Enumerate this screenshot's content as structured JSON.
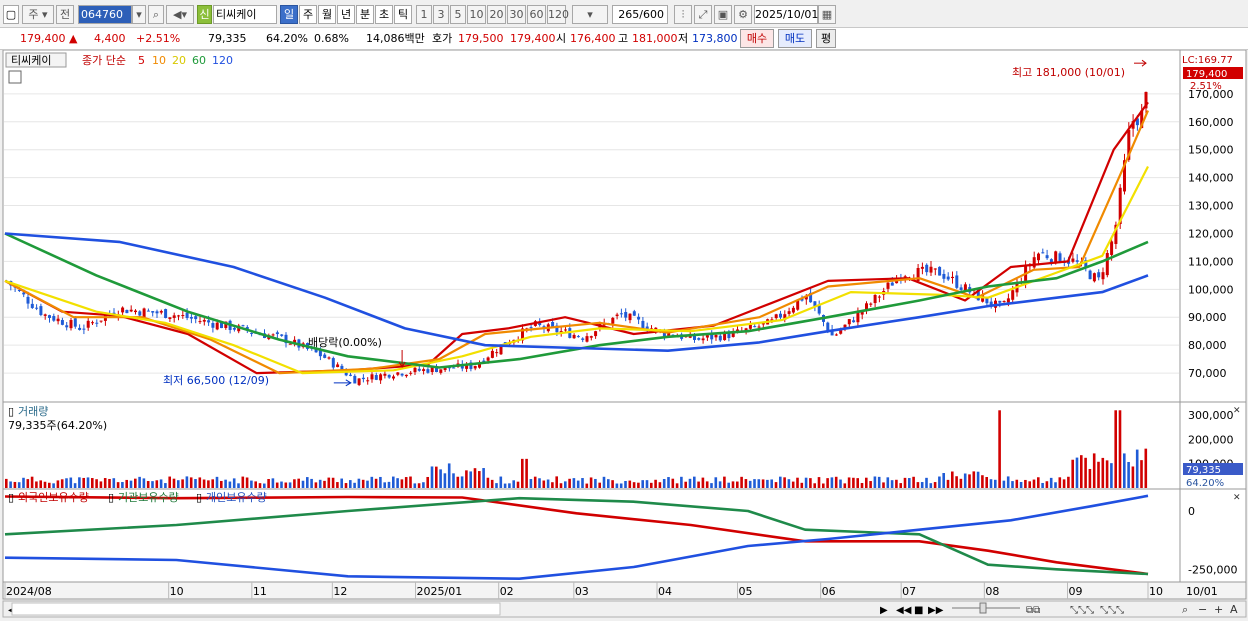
{
  "toolbar": {
    "period_selector": "주",
    "prev_label": "전",
    "stock_code": "064760",
    "credit_badge": "신",
    "stock_name": "티씨케이",
    "timeframes": [
      "일",
      "주",
      "월",
      "년",
      "분",
      "초",
      "틱"
    ],
    "active_timeframe": "일",
    "minute_intervals": [
      "1",
      "3",
      "5",
      "10",
      "20",
      "30",
      "60",
      "120"
    ],
    "count_value": "265",
    "count_total": "/600",
    "date_value": "2025/10/01"
  },
  "quote": {
    "price": "179,400",
    "change": "4,400",
    "change_pct": "+2.51%",
    "volume": "79,335",
    "volume_ratio": "64.20%",
    "turnover": "0.68%",
    "amount": "14,086백만",
    "bid_label": "호가",
    "bid": "179,500",
    "ask": "179,400",
    "open_label": "시",
    "open": "176,400",
    "high_label": "고",
    "high": "181,000",
    "low_label": "저",
    "low": "173,800",
    "buy_button": "매수",
    "sell_button": "매도",
    "eval_button": "평"
  },
  "chart_labels": {
    "stock_tab": "티씨케이",
    "ma_title": "종가 단순",
    "ma_periods": [
      "5",
      "10",
      "20",
      "60",
      "120"
    ],
    "lc_label": "LC:169.77",
    "current_price_tag": "179,400",
    "current_pct_tag": "2.51%",
    "high_annotation": "최고 181,000 (10/01)",
    "low_annotation": "최저 66,500 (12/09)",
    "split_annotation": "배당락(0.00%)",
    "volume_title": "거래량",
    "volume_value": "79,335주(64.20%)",
    "volume_tag": "79,335",
    "volume_pct_tag": "64.20%",
    "holdings_titles": [
      "외국인보유수량",
      "기관보유수량",
      "개인보유수량"
    ],
    "date_axis_right": "10/01"
  },
  "colors": {
    "candle_up": "#d10000",
    "candle_down": "#1f5bd6",
    "ma5": "#d10000",
    "ma10": "#f08a00",
    "ma20": "#f2e000",
    "ma60": "#1f9a3a",
    "ma120": "#2050e0",
    "foreign": "#d10000",
    "institution": "#1f8a4a",
    "individual": "#2050e0"
  },
  "chart_data": [
    {
      "type": "candlestick",
      "title": "티씨케이",
      "ylim": [
        60000,
        185000
      ],
      "y_ticks": [
        70000,
        80000,
        90000,
        100000,
        110000,
        120000,
        130000,
        140000,
        150000,
        160000,
        170000
      ],
      "y_tick_labels": [
        "70,000",
        "80,000",
        "90,000",
        "100,000",
        "110,000",
        "120,000",
        "130,000",
        "140,000",
        "150,000",
        "160,000",
        "170,000"
      ],
      "x_month_labels": [
        "2024/08",
        "10",
        "11",
        "12",
        "2025/01",
        "02",
        "03",
        "04",
        "05",
        "06",
        "07",
        "08",
        "09",
        "10"
      ],
      "close_path": [
        [
          "2024-08-01",
          103000
        ],
        [
          "2024-08-15",
          91000
        ],
        [
          "2024-08-29",
          86000
        ],
        [
          "2024-09-12",
          93000
        ],
        [
          "2024-10-02",
          91000
        ],
        [
          "2024-10-16",
          88000
        ],
        [
          "2024-10-31",
          85000
        ],
        [
          "2024-11-13",
          82000
        ],
        [
          "2024-11-27",
          76000
        ],
        [
          "2024-12-09",
          67500
        ],
        [
          "2024-12-23",
          70000
        ],
        [
          "2025-01-08",
          71500
        ],
        [
          "2025-01-22",
          72500
        ],
        [
          "2025-02-03",
          81000
        ],
        [
          "2025-02-14",
          87000
        ],
        [
          "2025-03-04",
          83000
        ],
        [
          "2025-03-18",
          91000
        ],
        [
          "2025-04-01",
          85000
        ],
        [
          "2025-04-15",
          82000
        ],
        [
          "2025-04-29",
          84000
        ],
        [
          "2025-05-13",
          88000
        ],
        [
          "2025-05-26",
          98000
        ],
        [
          "2025-06-05",
          83000
        ],
        [
          "2025-06-18",
          94000
        ],
        [
          "2025-07-01",
          106000
        ],
        [
          "2025-07-15",
          106000
        ],
        [
          "2025-07-28",
          98000
        ],
        [
          "2025-08-07",
          93000
        ],
        [
          "2025-08-20",
          113000
        ],
        [
          "2025-09-03",
          110000
        ],
        [
          "2025-09-12",
          103000
        ],
        [
          "2025-09-18",
          120000
        ],
        [
          "2025-09-24",
          160000
        ],
        [
          "2025-09-29",
          163000
        ],
        [
          "2025-10-01",
          179400
        ]
      ],
      "moving_averages": [
        {
          "name": "5",
          "values": [
            [
              0,
              103000
            ],
            [
              0.05,
              92000
            ],
            [
              0.1,
              90500
            ],
            [
              0.16,
              84000
            ],
            [
              0.22,
              70000
            ],
            [
              0.3,
              71000
            ],
            [
              0.37,
              73000
            ],
            [
              0.4,
              84000
            ],
            [
              0.44,
              86000
            ],
            [
              0.49,
              90000
            ],
            [
              0.55,
              84000
            ],
            [
              0.62,
              87000
            ],
            [
              0.67,
              95000
            ],
            [
              0.72,
              103000
            ],
            [
              0.79,
              104000
            ],
            [
              0.84,
              96000
            ],
            [
              0.88,
              108000
            ],
            [
              0.93,
              110000
            ],
            [
              0.97,
              150000
            ],
            [
              1.0,
              167000
            ]
          ]
        },
        {
          "name": "10",
          "values": [
            [
              0,
              103000
            ],
            [
              0.06,
              90000
            ],
            [
              0.12,
              90000
            ],
            [
              0.18,
              82000
            ],
            [
              0.24,
              70000
            ],
            [
              0.32,
              71500
            ],
            [
              0.38,
              75000
            ],
            [
              0.42,
              84000
            ],
            [
              0.47,
              86000
            ],
            [
              0.52,
              88000
            ],
            [
              0.58,
              84500
            ],
            [
              0.66,
              90000
            ],
            [
              0.72,
              101000
            ],
            [
              0.8,
              104000
            ],
            [
              0.85,
              97000
            ],
            [
              0.9,
              107000
            ],
            [
              0.94,
              108000
            ],
            [
              0.98,
              145000
            ],
            [
              1.0,
              164000
            ]
          ]
        },
        {
          "name": "20",
          "values": [
            [
              0,
              103000
            ],
            [
              0.08,
              92000
            ],
            [
              0.14,
              88000
            ],
            [
              0.2,
              80000
            ],
            [
              0.26,
              70000
            ],
            [
              0.34,
              71000
            ],
            [
              0.4,
              76000
            ],
            [
              0.46,
              83000
            ],
            [
              0.52,
              86000
            ],
            [
              0.6,
              85000
            ],
            [
              0.68,
              89000
            ],
            [
              0.74,
              99000
            ],
            [
              0.82,
              98000
            ],
            [
              0.86,
              97000
            ],
            [
              0.92,
              106000
            ],
            [
              0.96,
              112000
            ],
            [
              1.0,
              144000
            ]
          ]
        },
        {
          "name": "60",
          "values": [
            [
              0,
              120000
            ],
            [
              0.08,
              105000
            ],
            [
              0.16,
              92000
            ],
            [
              0.24,
              82000
            ],
            [
              0.3,
              76000
            ],
            [
              0.38,
              72000
            ],
            [
              0.45,
              75000
            ],
            [
              0.52,
              80000
            ],
            [
              0.58,
              83000
            ],
            [
              0.65,
              85000
            ],
            [
              0.72,
              90000
            ],
            [
              0.8,
              96000
            ],
            [
              0.86,
              101000
            ],
            [
              0.92,
              104000
            ],
            [
              0.96,
              110000
            ],
            [
              1.0,
              117000
            ]
          ]
        },
        {
          "name": "120",
          "values": [
            [
              0,
              120000
            ],
            [
              0.1,
              117000
            ],
            [
              0.2,
              108000
            ],
            [
              0.28,
              97000
            ],
            [
              0.35,
              86000
            ],
            [
              0.42,
              80000
            ],
            [
              0.5,
              79000
            ],
            [
              0.58,
              78000
            ],
            [
              0.66,
              81000
            ],
            [
              0.72,
              85000
            ],
            [
              0.8,
              90000
            ],
            [
              0.86,
              94000
            ],
            [
              0.92,
              97000
            ],
            [
              0.96,
              99000
            ],
            [
              1.0,
              105000
            ]
          ]
        }
      ],
      "annotations": {
        "high": 181000,
        "low": 66500,
        "ex_dividend_pct": 0.0
      }
    },
    {
      "type": "bar",
      "title": "거래량",
      "ylim": [
        0,
        350000
      ],
      "y_ticks": [
        100000,
        200000,
        300000
      ],
      "y_tick_labels": [
        "100,000",
        "200,000",
        "300,000"
      ],
      "last_value": 79335,
      "peaks": [
        [
          "2025-02-10",
          120000
        ],
        [
          "2025-08-06",
          320000
        ],
        [
          "2025-09-19",
          320000
        ],
        [
          "2025-10-01",
          79335
        ]
      ]
    },
    {
      "type": "line",
      "title": "보유수량",
      "y_ticks": [
        0,
        -250000
      ],
      "y_tick_labels": [
        "0",
        "-250,000"
      ],
      "series": [
        {
          "name": "외국인보유수량",
          "values": [
            [
              0,
              62000
            ],
            [
              0.15,
              55000
            ],
            [
              0.3,
              60000
            ],
            [
              0.4,
              58000
            ],
            [
              0.5,
              -10000
            ],
            [
              0.6,
              -60000
            ],
            [
              0.7,
              -130000
            ],
            [
              0.8,
              -130000
            ],
            [
              0.86,
              -170000
            ],
            [
              0.92,
              -220000
            ],
            [
              1.0,
              -270000
            ]
          ]
        },
        {
          "name": "기관보유수량",
          "values": [
            [
              0,
              -100000
            ],
            [
              0.15,
              -60000
            ],
            [
              0.3,
              0
            ],
            [
              0.45,
              55000
            ],
            [
              0.55,
              40000
            ],
            [
              0.65,
              0
            ],
            [
              0.7,
              -80000
            ],
            [
              0.8,
              -100000
            ],
            [
              0.86,
              -230000
            ],
            [
              0.92,
              -250000
            ],
            [
              1.0,
              -270000
            ]
          ]
        },
        {
          "name": "개인보유수량",
          "values": [
            [
              0,
              -200000
            ],
            [
              0.15,
              -210000
            ],
            [
              0.3,
              -280000
            ],
            [
              0.45,
              -290000
            ],
            [
              0.55,
              -240000
            ],
            [
              0.65,
              -150000
            ],
            [
              0.72,
              -120000
            ],
            [
              0.8,
              -80000
            ],
            [
              0.88,
              -40000
            ],
            [
              0.95,
              20000
            ],
            [
              1.0,
              65000
            ]
          ]
        }
      ]
    }
  ]
}
